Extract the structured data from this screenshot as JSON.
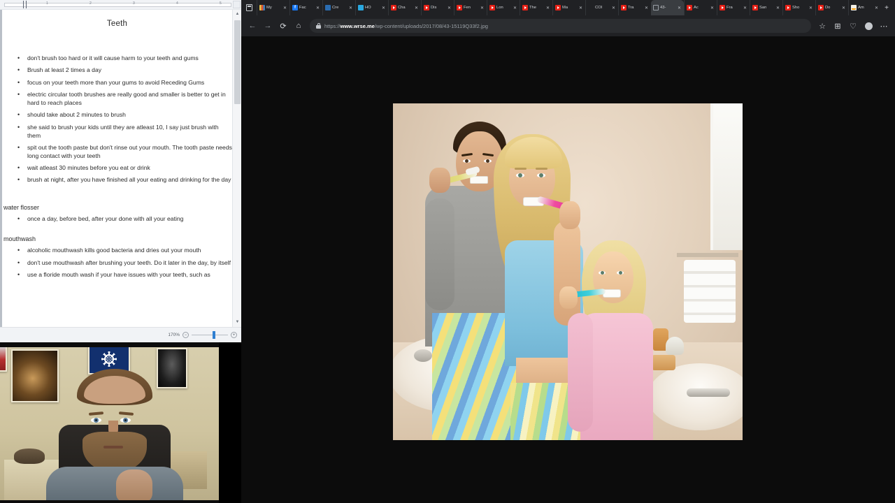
{
  "document": {
    "app": "word-document",
    "title": "Teeth",
    "ruler_ticks": [
      "1",
      "2",
      "3",
      "4",
      "5"
    ],
    "main_bullets": [
      "don't brush too hard or it will cause harm to your teeth and gums",
      "Brush at least 2 times a day",
      "focus on your teeth more than your gums to avoid Receding Gums",
      "electric circular tooth brushes are really good and smaller is better to get in hard to reach places",
      "should take about 2 minutes to brush",
      "she said to brush your kids until they are atleast 10, I say just brush with them",
      "spit out the tooth paste but don't rinse out  your mouth.  The tooth paste needs long contact with your teeth",
      "wait atleast 30 minutes before you eat or drink",
      "brush at night, after you have finished all your eating and drinking for the day"
    ],
    "section_flosser": {
      "heading": "water flosser",
      "bullets": [
        "once a day, before bed, after your done with all your eating"
      ]
    },
    "section_mouthwash": {
      "heading": "mouthwash",
      "bullets": [
        "alcoholic mouthwash kills good bacteria and dries out your mouth",
        "don't use mouthwash after brushing your teeth.  Do it later in the day, by itself",
        "use a floride mouth wash if your have issues with your teeth, such as"
      ]
    },
    "status_bar": {
      "zoom_level": "170%",
      "zoom_out_label": "−",
      "zoom_in_label": "+"
    },
    "scrollbar": {
      "up_arrow": "▲",
      "down_arrow": "▼"
    }
  },
  "browser": {
    "app": "microsoft-edge",
    "tab_list_icon": "tab-list-icon",
    "new_tab_label": "+",
    "tabs": [
      {
        "title": "My",
        "favicon": "books-icon",
        "close": "✕",
        "active": false
      },
      {
        "title": "Fac",
        "favicon": "facebook-icon",
        "close": "✕",
        "active": false
      },
      {
        "title": "Cre",
        "favicon": "blue-icon",
        "close": "✕",
        "active": false
      },
      {
        "title": "HO",
        "favicon": "bible-icon",
        "close": "✕",
        "active": false
      },
      {
        "title": "Cha",
        "favicon": "youtube-icon",
        "close": "✕",
        "active": false
      },
      {
        "title": "Dis",
        "favicon": "youtube-icon",
        "close": "✕",
        "active": false
      },
      {
        "title": "Fen",
        "favicon": "youtube-icon",
        "close": "✕",
        "active": false
      },
      {
        "title": "Lon",
        "favicon": "youtube-icon",
        "close": "✕",
        "active": false
      },
      {
        "title": "The",
        "favicon": "youtube-icon",
        "close": "✕",
        "active": false
      },
      {
        "title": "Ma",
        "favicon": "youtube-icon",
        "close": "✕",
        "active": false
      },
      {
        "title": "COI",
        "favicon": "plain-icon",
        "close": "✕",
        "active": false
      },
      {
        "title": "Tra",
        "favicon": "youtube-icon",
        "close": "✕",
        "active": false
      },
      {
        "title": "43-",
        "favicon": "image-icon",
        "close": "✕",
        "active": true
      },
      {
        "title": "Ac",
        "favicon": "youtube-icon",
        "close": "✕",
        "active": false
      },
      {
        "title": "Fra",
        "favicon": "youtube-icon",
        "close": "✕",
        "active": false
      },
      {
        "title": "San",
        "favicon": "youtube-icon",
        "close": "✕",
        "active": false
      },
      {
        "title": "Sho",
        "favicon": "youtube-icon",
        "close": "✕",
        "active": false
      },
      {
        "title": "Do",
        "favicon": "youtube-icon",
        "close": "✕",
        "active": false
      },
      {
        "title": "Am",
        "favicon": "amazon-icon",
        "close": "✕",
        "active": false
      }
    ],
    "window_controls": {
      "minimize": "−",
      "maximize": "▢",
      "close": "✕"
    },
    "toolbar": {
      "back": "←",
      "forward": "→",
      "refresh": "⟳",
      "home": "⌂",
      "favorites": "☆",
      "collections": "⊞",
      "browser_essentials": "♡",
      "profile": "person-icon",
      "settings": "⋯"
    },
    "omnibox": {
      "lock_icon": "lock-icon",
      "url_scheme": "https://",
      "url_host": "www.wrse.me",
      "url_path": "/wp-content/uploads/2017/08/43-15119Q33f2.jpg"
    },
    "page_background": "#0c0c0c"
  },
  "photo": {
    "name": "family-brushing-teeth-photo",
    "description": "Stock photo of a man, woman and young girl brushing their teeth together in a bathroom",
    "alt": "family brushing teeth"
  },
  "webcam": {
    "name": "webcam-overlay",
    "description": "Webcam feed of a bearded man seated in an office chair with posters and a NATO flag on the wall behind him"
  },
  "colors": {
    "browser_chrome": "#202124",
    "tab_active": "#3a3d41",
    "omnibox": "#2b2d30",
    "page_bg": "#0c0c0c",
    "doc_bg": "#ffffff",
    "accent_blue": "#2f7fd1",
    "youtube_red": "#e62117"
  }
}
